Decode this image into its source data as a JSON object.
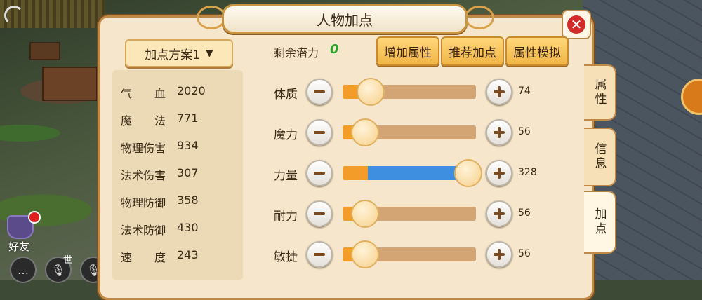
{
  "panel": {
    "title": "人物加点"
  },
  "scheme": {
    "label": "加点方案1"
  },
  "stats": [
    {
      "name": "气　　血",
      "value": "2020"
    },
    {
      "name": "魔　　法",
      "value": "771"
    },
    {
      "name": "物理伤害",
      "value": "934"
    },
    {
      "name": "法术伤害",
      "value": "307"
    },
    {
      "name": "物理防御",
      "value": "358"
    },
    {
      "name": "法术防御",
      "value": "430"
    },
    {
      "name": "速　　度",
      "value": "243"
    }
  ],
  "remaining": {
    "label": "剩余潜力",
    "value": "0"
  },
  "buttons": {
    "add_attr": "增加属性",
    "recommend": "推荐加点",
    "simulate": "属性模拟"
  },
  "attributes": [
    {
      "name": "体质",
      "value": "74",
      "base_fraction": 0.2,
      "added_fraction": 0,
      "knob_fraction": 0.2
    },
    {
      "name": "魔力",
      "value": "56",
      "base_fraction": 0.16,
      "added_fraction": 0,
      "knob_fraction": 0.16
    },
    {
      "name": "力量",
      "value": "328",
      "base_fraction": 0.19,
      "added_fraction": 0.81,
      "knob_fraction": 0.93
    },
    {
      "name": "耐力",
      "value": "56",
      "base_fraction": 0.16,
      "added_fraction": 0,
      "knob_fraction": 0.16
    },
    {
      "name": "敏捷",
      "value": "56",
      "base_fraction": 0.16,
      "added_fraction": 0,
      "knob_fraction": 0.16
    }
  ],
  "side_tabs": [
    "属性",
    "信息",
    "加点"
  ],
  "hud": {
    "friend": "好友",
    "world": "世"
  },
  "colors": {
    "base_fill": "#f39c2a",
    "added_fill": "#3f8fe0",
    "potential": "#2aa52a",
    "close": "#d32a2a"
  }
}
